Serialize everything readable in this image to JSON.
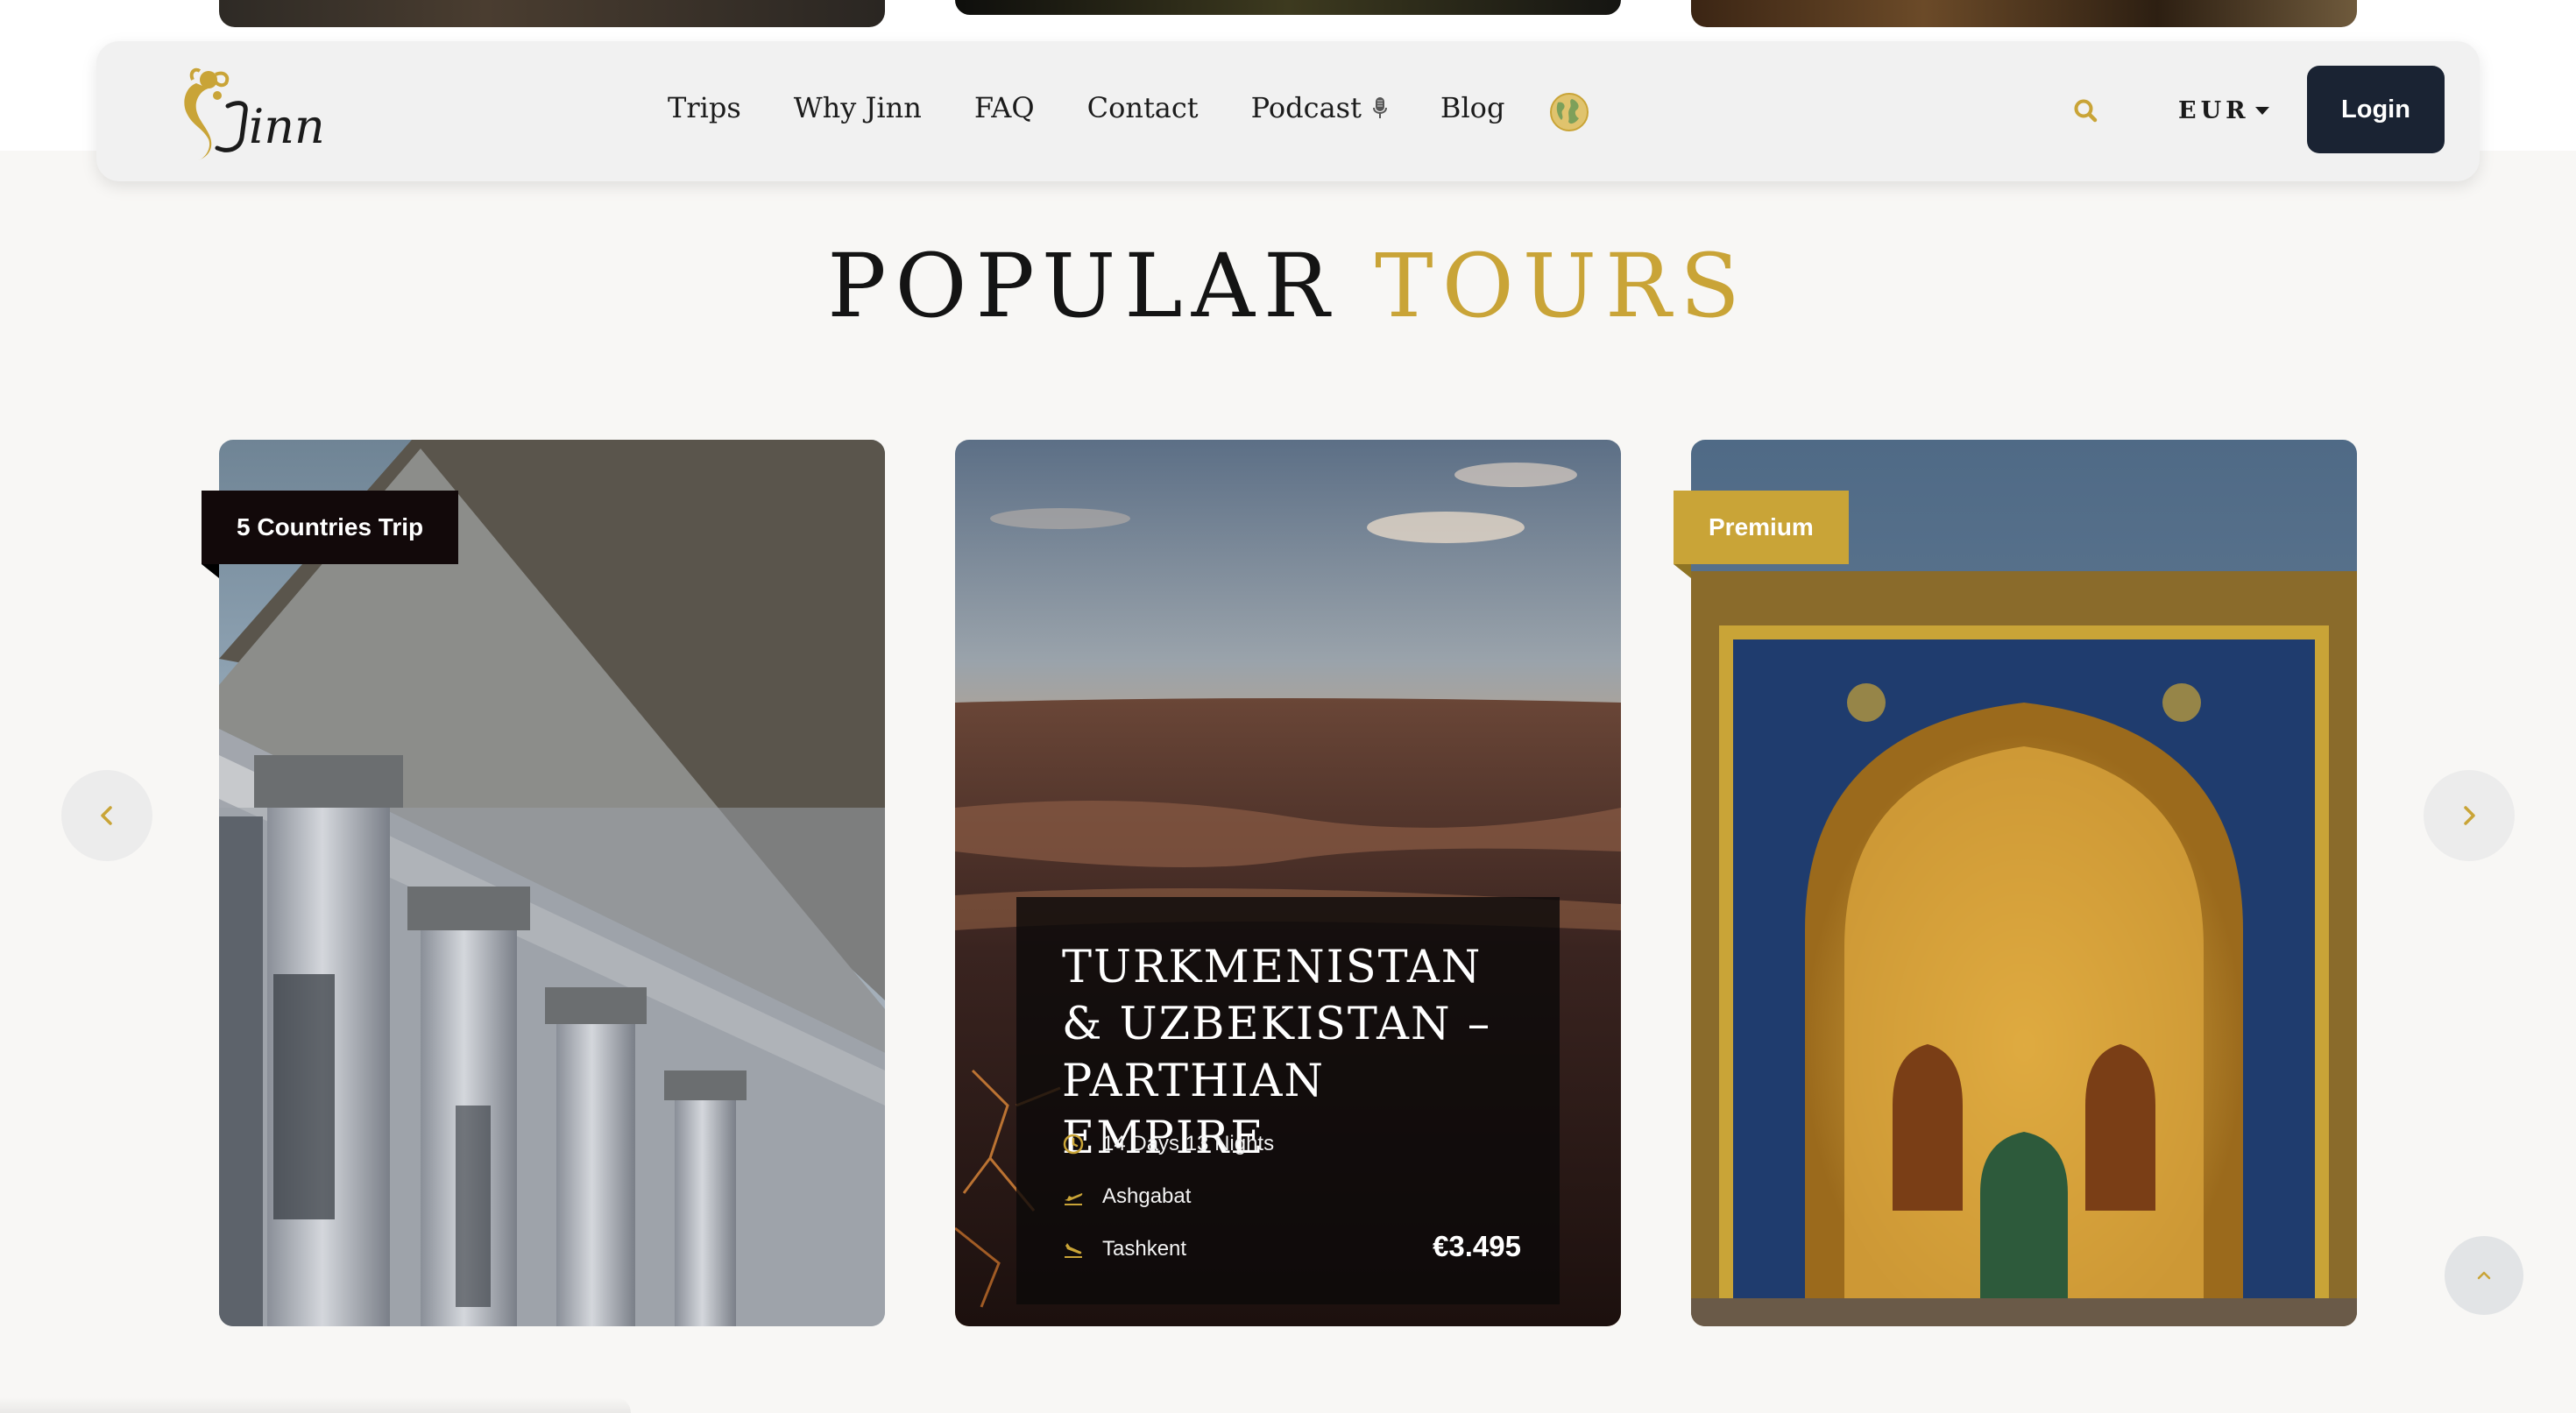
{
  "brand": {
    "name": "Jinn",
    "accent": "#c9a437",
    "dark": "#1a2333"
  },
  "nav": {
    "items": [
      {
        "label": "Trips"
      },
      {
        "label": "Why Jinn"
      },
      {
        "label": "FAQ"
      },
      {
        "label": "Contact"
      },
      {
        "label": "Podcast",
        "icon": "microphone-icon"
      },
      {
        "label": "Blog"
      }
    ],
    "language_icon": "globe-icon",
    "search_icon": "search-icon",
    "currency": "EUR",
    "login_label": "Login"
  },
  "section": {
    "title_dark": "POPULAR",
    "title_accent": "TOURS"
  },
  "tours": [
    {
      "badge": "5 Countries Trip",
      "image": "neoclassical-columns-photo"
    },
    {
      "title": "TURKMENISTAN & UZBEKISTAN – PARTHIAN EMPIRE",
      "duration": "14 Days 13 Nights",
      "departure": "Ashgabat",
      "arrival": "Tashkent",
      "price": "€3.495",
      "image": "desert-canyon-sunset-photo"
    },
    {
      "badge": "Premium",
      "image": "tiled-mosque-portal-photo"
    }
  ],
  "carousel": {
    "prev_icon": "chevron-left-icon",
    "next_icon": "chevron-right-icon"
  },
  "scroll_top_icon": "chevron-up-icon"
}
